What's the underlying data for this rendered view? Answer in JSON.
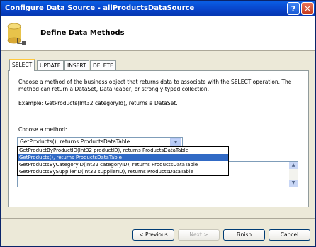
{
  "window": {
    "title": "Configure Data Source - allProductsDataSource"
  },
  "titlebar": {
    "help": "?",
    "close": "✕"
  },
  "header": {
    "title": "Define Data Methods",
    "icon": "database-icon"
  },
  "tabs": [
    {
      "label": "SELECT"
    },
    {
      "label": "UPDATE"
    },
    {
      "label": "INSERT"
    },
    {
      "label": "DELETE"
    }
  ],
  "select_tab": {
    "description": "Choose a method of the business object that returns data to associate with the SELECT operation. The method can return a DataSet, DataReader, or strongly-typed collection.",
    "example": "Example: GetProducts(Int32 categoryId), returns a DataSet.",
    "method_label": "Choose a method:",
    "selected_method": "GetProducts(), returns ProductsDataTable",
    "methods": [
      "GetProductByProductID(Int32 productID), returns ProductsDataTable",
      "GetProducts(), returns ProductsDataTable",
      "GetProductsByCategoryID(Int32 categoryID), returns ProductsDataTable",
      "GetProductsBySupplierID(Int32 supplierID), returns ProductsDataTable"
    ]
  },
  "buttons": {
    "previous": "< Previous",
    "next": "Next >",
    "finish": "Finish",
    "cancel": "Cancel"
  }
}
